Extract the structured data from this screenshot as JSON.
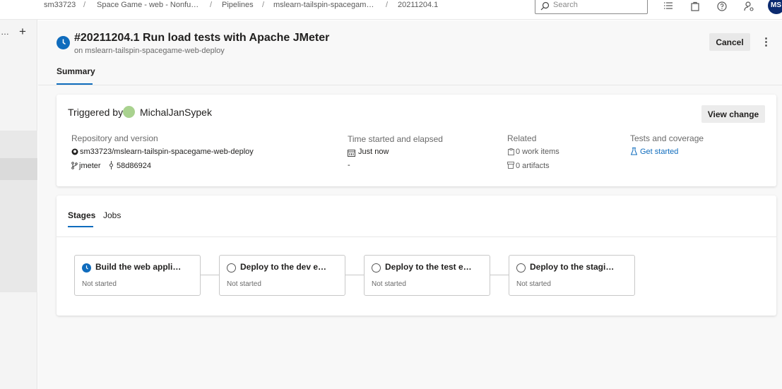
{
  "breadcrumbs": [
    "sm33723",
    "Space Game - web - Nonfu…",
    "Pipelines",
    "mslearn-tailspin-spacegam…",
    "20211204.1"
  ],
  "search": {
    "placeholder": "Search"
  },
  "user": {
    "initials": "MS"
  },
  "leftnav": {
    "overflow_label": "…",
    "add_label": "+"
  },
  "run": {
    "title": "#20211204.1 Run load tests with Apache JMeter",
    "subtitle": "on mslearn-tailspin-spacegame-web-deploy",
    "cancel_label": "Cancel",
    "more_label": "⋮"
  },
  "tabs": {
    "summary": "Summary"
  },
  "summary": {
    "triggered_by_label": "Triggered by",
    "triggered_by_user": "MichalJanSypek",
    "view_change_label": "View change",
    "repo_label": "Repository and version",
    "repo_name": "sm33723/mslearn-tailspin-spacegame-web-deploy",
    "branch": "jmeter",
    "commit": "58d86924",
    "time_label": "Time started and elapsed",
    "time_started": "Just now",
    "elapsed": "-",
    "related_label": "Related",
    "work_items": "0 work items",
    "artifacts": "0 artifacts",
    "tests_label": "Tests and coverage",
    "tests_link": "Get started"
  },
  "stages_tabs": {
    "stages": "Stages",
    "jobs": "Jobs"
  },
  "stages": [
    {
      "name": "Build the web appli…",
      "status": "Not started",
      "state": "running"
    },
    {
      "name": "Deploy to the dev e…",
      "status": "Not started",
      "state": "pending"
    },
    {
      "name": "Deploy to the test e…",
      "status": "Not started",
      "state": "pending"
    },
    {
      "name": "Deploy to the stagi…",
      "status": "Not started",
      "state": "pending"
    }
  ],
  "colors": {
    "accent": "#0f6cbd",
    "avatar_bg": "#0b2a6f"
  }
}
